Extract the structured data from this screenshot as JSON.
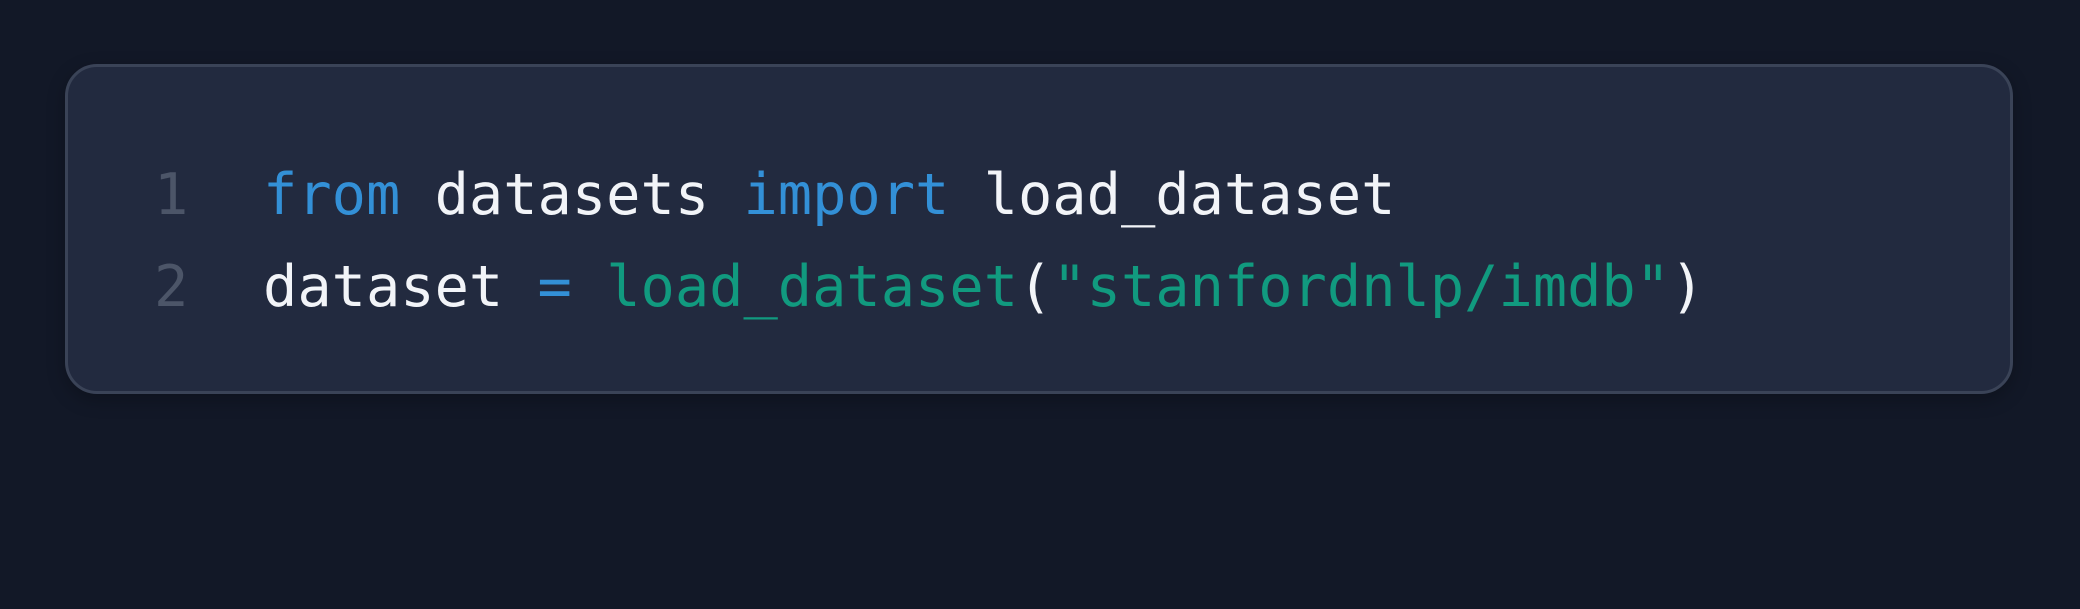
{
  "colors": {
    "background": "#121827",
    "card": "#222a3f",
    "border": "#3a4357",
    "keyword": "#3390d7",
    "identifier": "#f2f4f8",
    "function": "#119a7f",
    "string": "#119a7f",
    "line_number": "#4c5568"
  },
  "code": {
    "lines": [
      {
        "number": "1",
        "tokens": [
          {
            "text": "from",
            "kind": "keyword"
          },
          {
            "text": " datasets ",
            "kind": "ident"
          },
          {
            "text": "import",
            "kind": "keyword"
          },
          {
            "text": " load_dataset",
            "kind": "ident"
          }
        ]
      },
      {
        "number": "2",
        "tokens": [
          {
            "text": "dataset ",
            "kind": "ident"
          },
          {
            "text": "=",
            "kind": "op"
          },
          {
            "text": " ",
            "kind": "ident"
          },
          {
            "text": "load_dataset",
            "kind": "func"
          },
          {
            "text": "(",
            "kind": "punc"
          },
          {
            "text": "\"stanfordnlp/imdb\"",
            "kind": "string"
          },
          {
            "text": ")",
            "kind": "punc"
          }
        ]
      }
    ]
  }
}
